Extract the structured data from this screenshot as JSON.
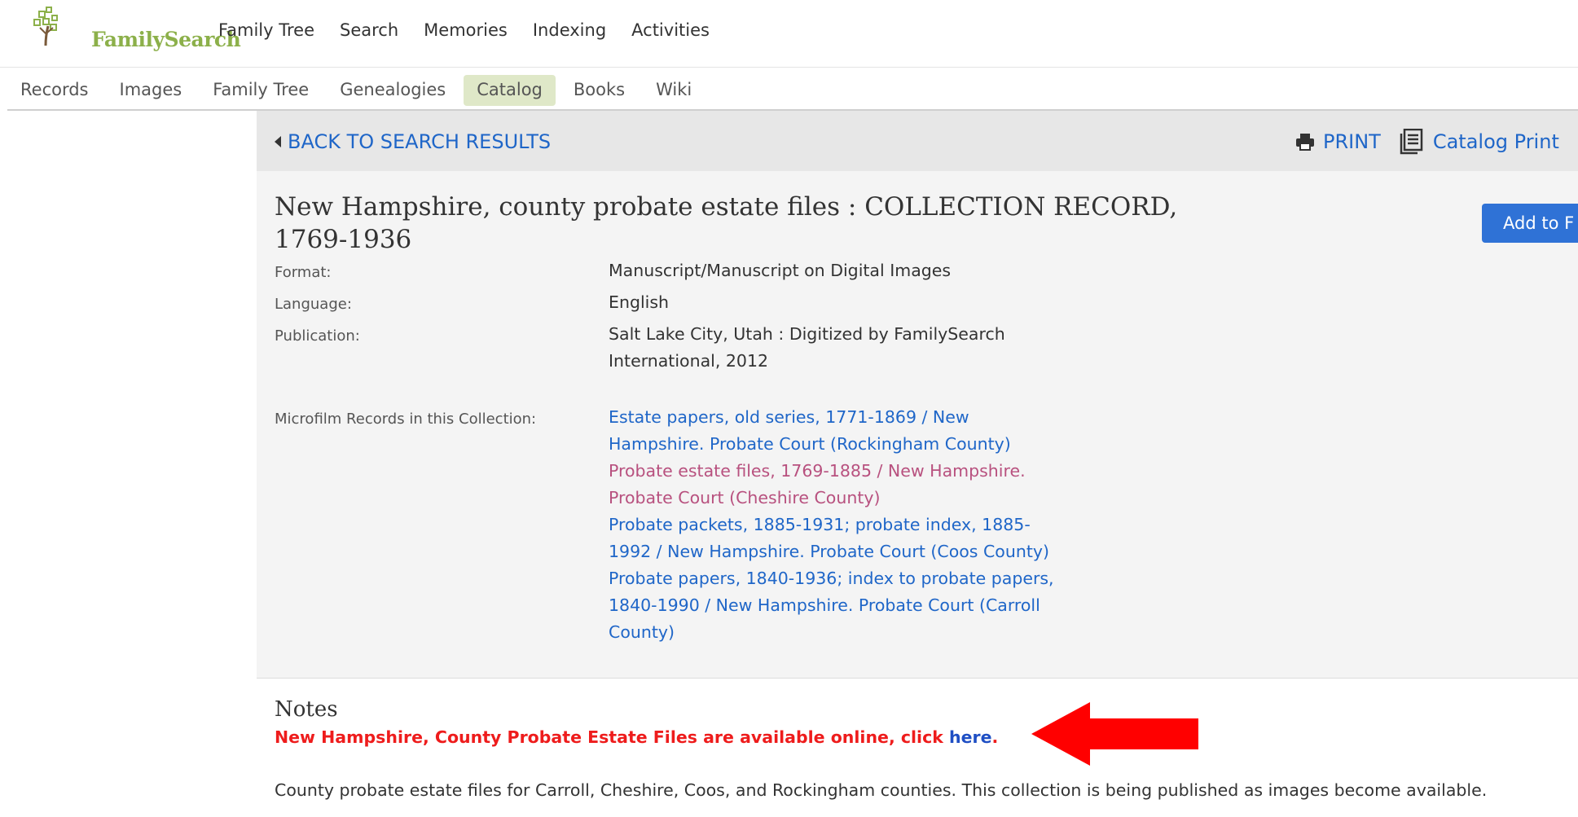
{
  "brand": {
    "name": "FamilySearch"
  },
  "top_nav": [
    "Family Tree",
    "Search",
    "Memories",
    "Indexing",
    "Activities"
  ],
  "sub_nav": {
    "items": [
      "Records",
      "Images",
      "Family Tree",
      "Genealogies",
      "Catalog",
      "Books",
      "Wiki"
    ],
    "active": "Catalog"
  },
  "toolbar": {
    "back_label": "BACK TO SEARCH RESULTS",
    "print_label": "PRINT",
    "catalog_print_label": "Catalog Print"
  },
  "record": {
    "title_line1": "New Hampshire, county probate estate files : COLLECTION RECORD,",
    "title_line2": "1769-1936",
    "add_button": "Add to F",
    "fields": {
      "format_label": "Format:",
      "format_value": "Manuscript/Manuscript on Digital Images",
      "language_label": "Language:",
      "language_value": "English",
      "publication_label": "Publication:",
      "publication_value_line1": "Salt Lake City, Utah : Digitized by FamilySearch",
      "publication_value_line2": "International, 2012",
      "microfilm_label": "Microfilm Records in this Collection:"
    },
    "microfilm_links": [
      {
        "line1": "Estate papers, old series, 1771-1869 / New",
        "line2": "Hampshire. Probate Court (Rockingham County)",
        "line3": "",
        "visited": false
      },
      {
        "line1": "Probate estate files, 1769-1885 / New Hampshire.",
        "line2": "Probate Court (Cheshire County)",
        "line3": "",
        "visited": true
      },
      {
        "line1": "Probate packets, 1885-1931; probate index, 1885-",
        "line2": "1992 / New Hampshire. Probate Court (Coos County)",
        "line3": "",
        "visited": false
      },
      {
        "line1": "Probate papers, 1840-1936; index to probate papers,",
        "line2": "1840-1990 / New Hampshire. Probate Court (Carroll",
        "line3": "County)",
        "visited": false
      }
    ]
  },
  "notes": {
    "title": "Notes",
    "alert_text": "New Hampshire, County Probate Estate Files are available online, click ",
    "alert_link": "here",
    "alert_end": ".",
    "description": "County probate estate files for Carroll, Cheshire, Coos, and Rockingham counties. This collection is being published as images become available."
  },
  "colors": {
    "link": "#1f66c8",
    "visited_link": "#b8517f",
    "alert": "#ee1c1c",
    "brand_green": "#8cb04a",
    "button_blue": "#2f72d6"
  },
  "icons": [
    "familysearch-tree-logo-icon",
    "caret-left-icon",
    "printer-icon",
    "catalog-print-icon",
    "red-arrow-icon"
  ]
}
